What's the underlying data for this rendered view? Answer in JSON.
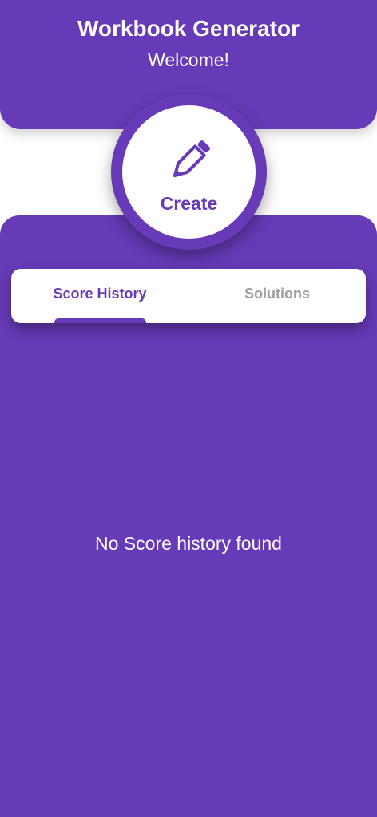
{
  "header": {
    "title": "Workbook Generator",
    "subtitle": "Welcome!"
  },
  "create_button": {
    "label": "Create",
    "icon": "pencil-icon"
  },
  "tabs": [
    {
      "label": "Score History",
      "selected": true
    },
    {
      "label": "Solutions",
      "selected": false
    }
  ],
  "empty_state": {
    "message": "No Score history found"
  },
  "colors": {
    "primary": "#673ab7",
    "surface": "#ffffff",
    "inactive_tab": "#9e9e9e"
  }
}
